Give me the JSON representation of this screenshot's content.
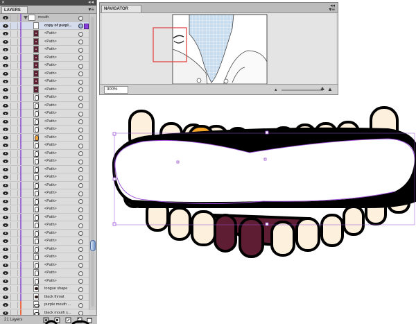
{
  "layers_panel": {
    "tab_label": "LAYERS",
    "layer_count_label": "21 Layers",
    "group_name": "mouth",
    "rows": [
      {
        "name": "copy of purpl...",
        "thumb": "blank",
        "selected": true,
        "bar": "purple"
      },
      {
        "name": "<Path>",
        "thumb": "dot",
        "bar": "purple"
      },
      {
        "name": "<Path>",
        "thumb": "dot",
        "bar": "purple"
      },
      {
        "name": "<Path>",
        "thumb": "dot",
        "bar": "purple"
      },
      {
        "name": "<Path>",
        "thumb": "dot",
        "bar": "purple"
      },
      {
        "name": "<Path>",
        "thumb": "dot",
        "bar": "purple"
      },
      {
        "name": "<Path>",
        "thumb": "dot",
        "bar": "purple"
      },
      {
        "name": "<Path>",
        "thumb": "dot",
        "bar": "purple"
      },
      {
        "name": "<Path>",
        "thumb": "dot",
        "bar": "purple"
      },
      {
        "name": "<Path>",
        "thumb": "ring",
        "bar": "purple"
      },
      {
        "name": "<Path>",
        "thumb": "ring",
        "bar": "purple"
      },
      {
        "name": "<Path>",
        "thumb": "ring",
        "bar": "purple"
      },
      {
        "name": "<Path>",
        "thumb": "ring",
        "bar": "purple"
      },
      {
        "name": "<Path>",
        "thumb": "ring",
        "bar": "purple"
      },
      {
        "name": "<Path>",
        "thumb": "orange",
        "bar": "purple"
      },
      {
        "name": "<Path>",
        "thumb": "ring",
        "bar": "purple"
      },
      {
        "name": "<Path>",
        "thumb": "ring",
        "bar": "purple"
      },
      {
        "name": "<Path>",
        "thumb": "ring",
        "bar": "purple"
      },
      {
        "name": "<Path>",
        "thumb": "ring",
        "bar": "purple"
      },
      {
        "name": "<Path>",
        "thumb": "ring",
        "bar": "purple"
      },
      {
        "name": "<Path>",
        "thumb": "ring",
        "bar": "purple"
      },
      {
        "name": "<Path>",
        "thumb": "ring",
        "bar": "purple"
      },
      {
        "name": "<Path>",
        "thumb": "ring",
        "bar": "purple"
      },
      {
        "name": "<Path>",
        "thumb": "ring",
        "bar": "purple"
      },
      {
        "name": "<Path>",
        "thumb": "ring",
        "bar": "purple"
      },
      {
        "name": "<Path>",
        "thumb": "ring",
        "bar": "purple"
      },
      {
        "name": "<Path>",
        "thumb": "ring",
        "bar": "purple"
      },
      {
        "name": "<Path>",
        "thumb": "ring",
        "bar": "purple"
      },
      {
        "name": "<Path>",
        "thumb": "ring",
        "bar": "purple"
      },
      {
        "name": "<Path>",
        "thumb": "ring",
        "bar": "purple"
      },
      {
        "name": "<Path>",
        "thumb": "ring",
        "bar": "purple"
      },
      {
        "name": "<Path>",
        "thumb": "ring",
        "bar": "purple"
      },
      {
        "name": "<Path>",
        "thumb": "ring",
        "bar": "purple"
      },
      {
        "name": "tongue shape",
        "thumb": "dark",
        "bar": "purple"
      },
      {
        "name": "black throat",
        "thumb": "dark",
        "bar": "purple"
      },
      {
        "name": "purple mouth ...",
        "thumb": "mouthshape",
        "bar": "red"
      },
      {
        "name": "black mouth s...",
        "thumb": "mouthshape",
        "bar": "red"
      }
    ]
  },
  "navigator_panel": {
    "tab_label": "NAVIGATOR",
    "zoom_value": "300%"
  },
  "colors": {
    "tooth_fill": "#fdf0dd",
    "orange_tooth": "#f6a52b",
    "gum_maroon": "#5f1d34",
    "selection_purple": "#9a4dd6",
    "layer_color_bar": "#9d6bd6",
    "viewbox_red": "#e23a3a"
  }
}
